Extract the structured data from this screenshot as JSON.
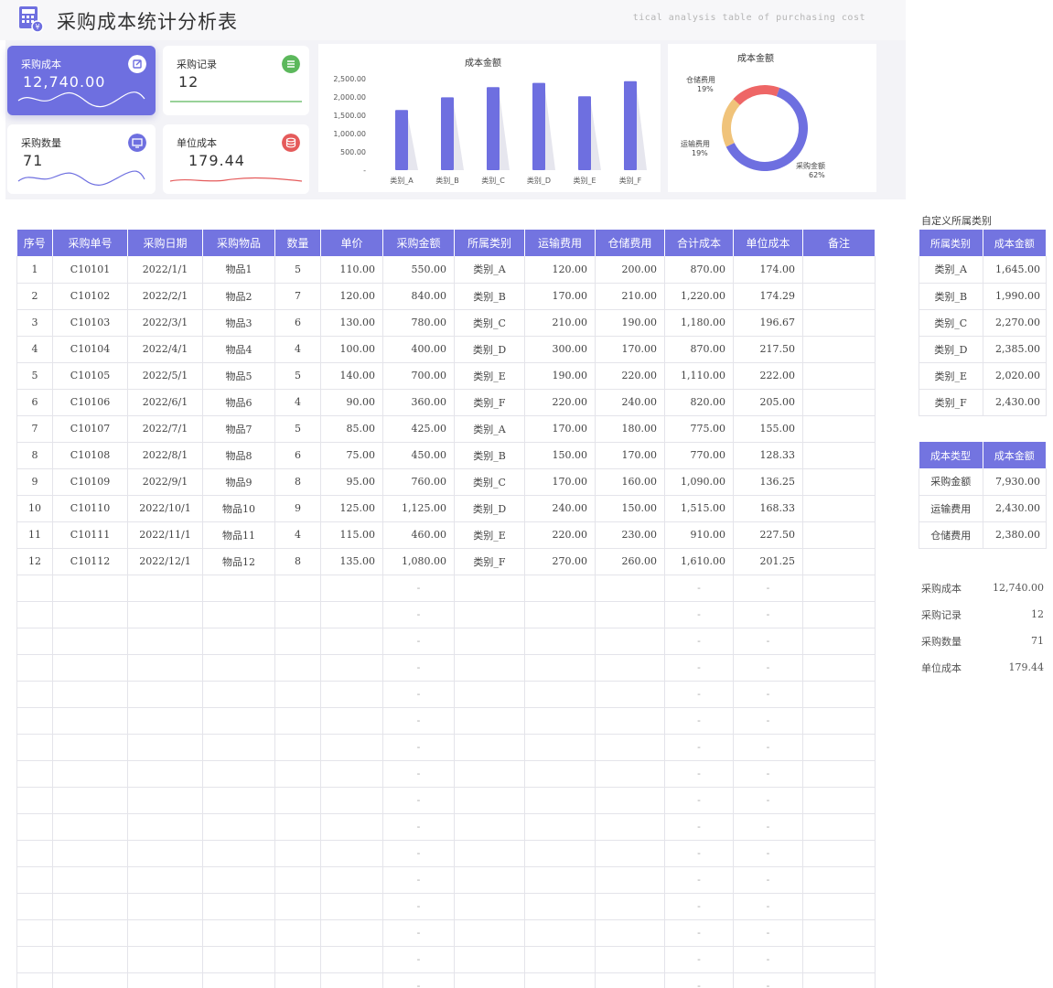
{
  "header": {
    "title": "采购成本统计分析表",
    "subtitle": "tical analysis table of purchasing cost"
  },
  "kpis": [
    {
      "label": "采购成本",
      "value": "12,740.00",
      "icon": "edit-icon",
      "color": "#ffffff"
    },
    {
      "label": "采购记录",
      "value": "12",
      "icon": "list-icon",
      "color": "#5cb85c"
    },
    {
      "label": "采购数量",
      "value": "71",
      "icon": "monitor-icon",
      "color": "#6e6fe0"
    },
    {
      "label": "单位成本",
      "value": "179.44",
      "icon": "database-icon",
      "color": "#e55b5b"
    }
  ],
  "chart_data": [
    {
      "type": "bar",
      "title": "成本金额",
      "categories": [
        "类别_A",
        "类别_B",
        "类别_C",
        "类别_D",
        "类别_E",
        "类别_F"
      ],
      "values": [
        1645,
        1990,
        2270,
        2385,
        2020,
        2430
      ],
      "yticks": [
        "2,500.00",
        "2,000.00",
        "1,500.00",
        "1,000.00",
        "500.00",
        "-"
      ],
      "ylim": [
        0,
        2500
      ],
      "color": "#6e6fe0"
    },
    {
      "type": "pie",
      "title": "成本金额",
      "labels": [
        "采购金额",
        "运输费用",
        "仓储费用"
      ],
      "values": [
        7930,
        2430,
        2380
      ],
      "pct_labels": [
        "62%",
        "19%",
        "19%"
      ],
      "colors": [
        "#6e6fe0",
        "#f0c37a",
        "#ee6666"
      ]
    }
  ],
  "table": {
    "headers": [
      "序号",
      "采购单号",
      "采购日期",
      "采购物品",
      "数量",
      "单价",
      "采购金额",
      "所属类别",
      "运输费用",
      "仓储费用",
      "合计成本",
      "单位成本",
      "备注"
    ],
    "rows": [
      [
        "1",
        "C10101",
        "2022/1/1",
        "物品1",
        "5",
        "110.00",
        "550.00",
        "类别_A",
        "120.00",
        "200.00",
        "870.00",
        "174.00",
        ""
      ],
      [
        "2",
        "C10102",
        "2022/2/1",
        "物品2",
        "7",
        "120.00",
        "840.00",
        "类别_B",
        "170.00",
        "210.00",
        "1,220.00",
        "174.29",
        ""
      ],
      [
        "3",
        "C10103",
        "2022/3/1",
        "物品3",
        "6",
        "130.00",
        "780.00",
        "类别_C",
        "210.00",
        "190.00",
        "1,180.00",
        "196.67",
        ""
      ],
      [
        "4",
        "C10104",
        "2022/4/1",
        "物品4",
        "4",
        "100.00",
        "400.00",
        "类别_D",
        "300.00",
        "170.00",
        "870.00",
        "217.50",
        ""
      ],
      [
        "5",
        "C10105",
        "2022/5/1",
        "物品5",
        "5",
        "140.00",
        "700.00",
        "类别_E",
        "190.00",
        "220.00",
        "1,110.00",
        "222.00",
        ""
      ],
      [
        "6",
        "C10106",
        "2022/6/1",
        "物品6",
        "4",
        "90.00",
        "360.00",
        "类别_F",
        "220.00",
        "240.00",
        "820.00",
        "205.00",
        ""
      ],
      [
        "7",
        "C10107",
        "2022/7/1",
        "物品7",
        "5",
        "85.00",
        "425.00",
        "类别_A",
        "170.00",
        "180.00",
        "775.00",
        "155.00",
        ""
      ],
      [
        "8",
        "C10108",
        "2022/8/1",
        "物品8",
        "6",
        "75.00",
        "450.00",
        "类别_B",
        "150.00",
        "170.00",
        "770.00",
        "128.33",
        ""
      ],
      [
        "9",
        "C10109",
        "2022/9/1",
        "物品9",
        "8",
        "95.00",
        "760.00",
        "类别_C",
        "170.00",
        "160.00",
        "1,090.00",
        "136.25",
        ""
      ],
      [
        "10",
        "C10110",
        "2022/10/1",
        "物品10",
        "9",
        "125.00",
        "1,125.00",
        "类别_D",
        "240.00",
        "150.00",
        "1,515.00",
        "168.33",
        ""
      ],
      [
        "11",
        "C10111",
        "2022/11/1",
        "物品11",
        "4",
        "115.00",
        "460.00",
        "类别_E",
        "220.00",
        "230.00",
        "910.00",
        "227.50",
        ""
      ],
      [
        "12",
        "C10112",
        "2022/12/1",
        "物品12",
        "8",
        "135.00",
        "1,080.00",
        "类别_F",
        "270.00",
        "260.00",
        "1,610.00",
        "201.25",
        ""
      ]
    ],
    "empty_dash": "-"
  },
  "category_table": {
    "title": "自定义所属类别",
    "headers": [
      "所属类别",
      "成本金额"
    ],
    "rows": [
      [
        "类别_A",
        "1,645.00"
      ],
      [
        "类别_B",
        "1,990.00"
      ],
      [
        "类别_C",
        "2,270.00"
      ],
      [
        "类别_D",
        "2,385.00"
      ],
      [
        "类别_E",
        "2,020.00"
      ],
      [
        "类别_F",
        "2,430.00"
      ]
    ]
  },
  "cost_type_table": {
    "headers": [
      "成本类型",
      "成本金额"
    ],
    "rows": [
      [
        "采购金额",
        "7,930.00"
      ],
      [
        "运输费用",
        "2,430.00"
      ],
      [
        "仓储费用",
        "2,380.00"
      ]
    ]
  },
  "summary": [
    {
      "label": "采购成本",
      "value": "12,740.00"
    },
    {
      "label": "采购记录",
      "value": "12"
    },
    {
      "label": "采购数量",
      "value": "71"
    },
    {
      "label": "单位成本",
      "value": "179.44"
    }
  ]
}
